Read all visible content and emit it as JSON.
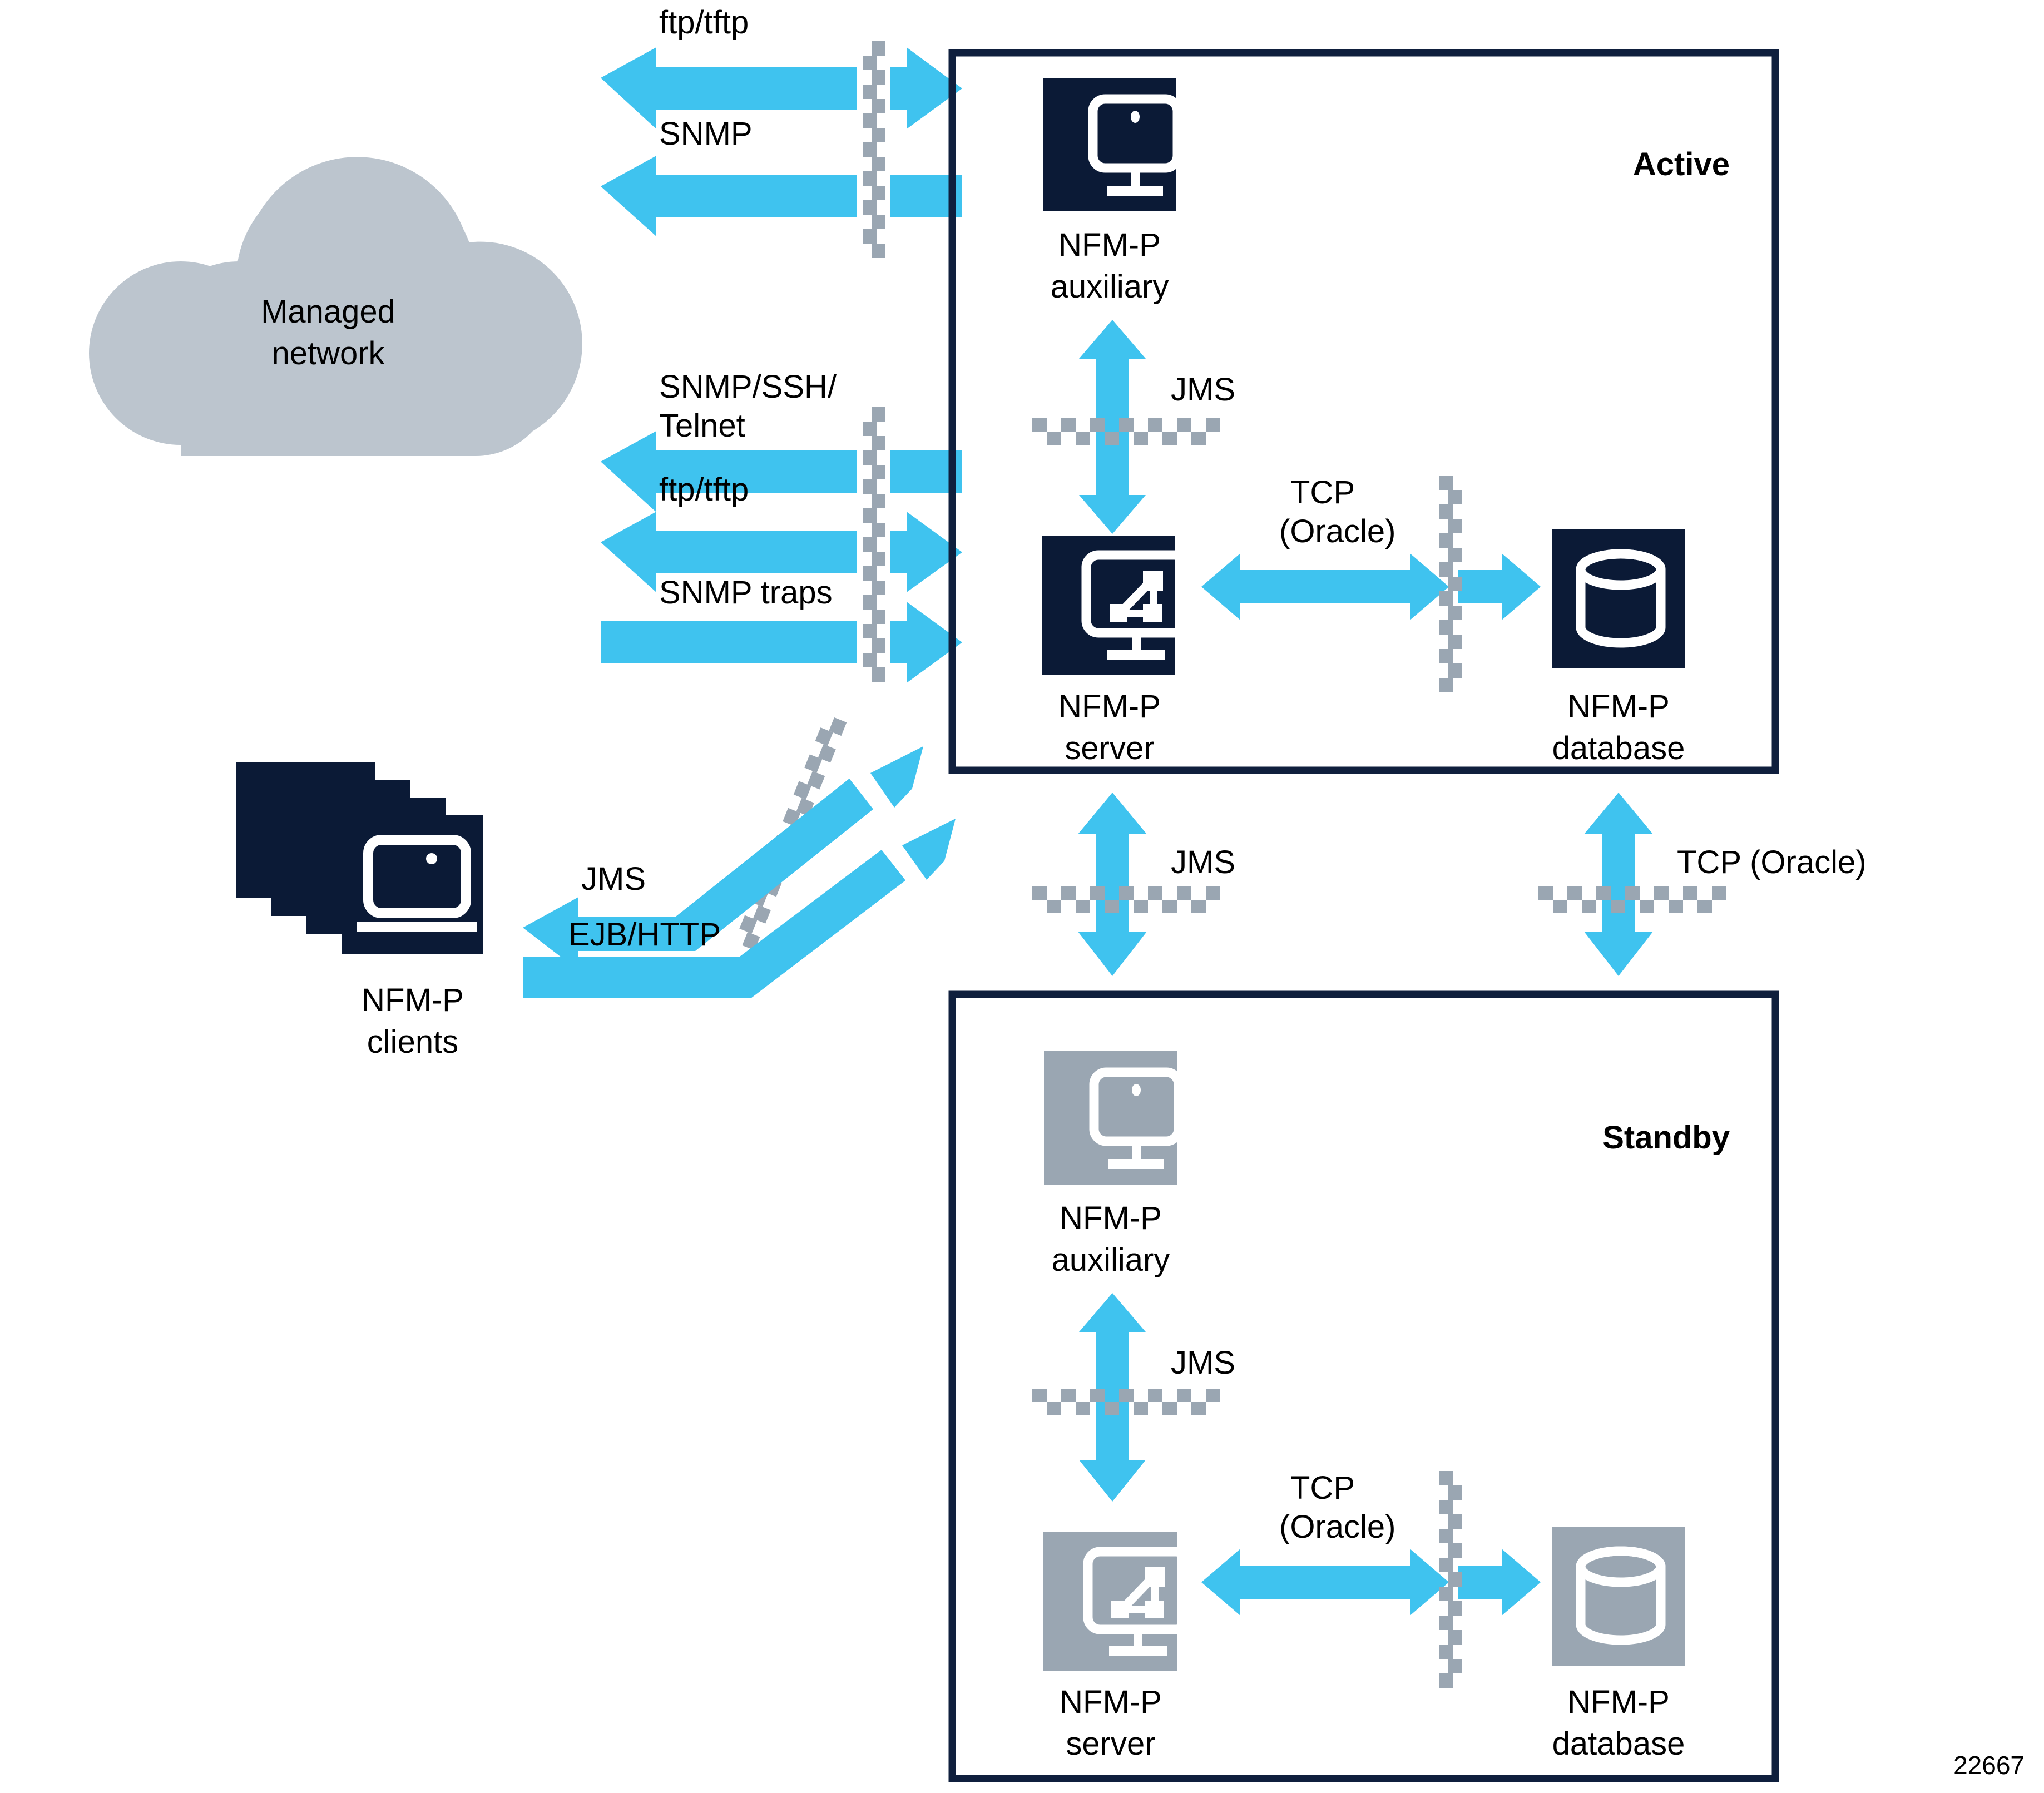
{
  "figure": {
    "id": "22667",
    "background": "#ffffff",
    "colors": {
      "arrow_blue": "#3FC3EF",
      "node_navy": "#0B1A36",
      "node_gray": "#9AA6B2",
      "cloud_gray": "#BCC5CE",
      "firewall_gray": "#9AA6B2",
      "border_navy": "#0F1F3D",
      "text_black": "#000000",
      "icon_white": "#ffffff"
    }
  },
  "cloud": {
    "label_line1": "Managed",
    "label_line2": "network"
  },
  "clients": {
    "label_line1": "NFM-P",
    "label_line2": "clients",
    "icon": "client-stack-icon",
    "stack_count": 4
  },
  "active_group": {
    "title": "Active",
    "nodes": [
      {
        "id": "active-auxiliary",
        "label_line1": "NFM-P",
        "label_line2": "auxiliary",
        "icon": "monitor-icon",
        "color": "#0B1A36"
      },
      {
        "id": "active-server",
        "label_line1": "NFM-P",
        "label_line2": "server",
        "icon": "server-topology-icon",
        "color": "#0B1A36"
      },
      {
        "id": "active-database",
        "label_line1": "NFM-P",
        "label_line2": "database",
        "icon": "database-cylinder-icon",
        "color": "#0B1A36"
      }
    ],
    "internal_links": [
      {
        "id": "active-jms-link",
        "label": "JMS",
        "direction": "bidirectional-vertical",
        "firewall": true
      },
      {
        "id": "active-tcp-link",
        "label_line1": "TCP",
        "label_line2": "(Oracle)",
        "direction": "bidirectional-horizontal",
        "firewall": true
      }
    ]
  },
  "standby_group": {
    "title": "Standby",
    "nodes": [
      {
        "id": "standby-auxiliary",
        "label_line1": "NFM-P",
        "label_line2": "auxiliary",
        "icon": "monitor-icon",
        "color": "#9AA6B2"
      },
      {
        "id": "standby-server",
        "label_line1": "NFM-P",
        "label_line2": "server",
        "icon": "server-topology-icon",
        "color": "#9AA6B2"
      },
      {
        "id": "standby-database",
        "label_line1": "NFM-P",
        "label_line2": "database",
        "icon": "database-cylinder-icon",
        "color": "#9AA6B2"
      }
    ],
    "internal_links": [
      {
        "id": "standby-jms-link",
        "label": "JMS",
        "direction": "bidirectional-vertical",
        "firewall": true
      },
      {
        "id": "standby-tcp-link",
        "label_line1": "TCP",
        "label_line2": "(Oracle)",
        "direction": "bidirectional-horizontal",
        "firewall": true
      }
    ]
  },
  "network_flows": [
    {
      "id": "flow-ftp-tftp-top",
      "label": "ftp/tftp",
      "direction": "bidirectional",
      "from": "Managed network",
      "to": "NFM-P auxiliary",
      "firewall": true
    },
    {
      "id": "flow-snmp-top",
      "label": "SNMP",
      "direction": "left",
      "from": "NFM-P auxiliary",
      "to": "Managed network",
      "firewall": true
    },
    {
      "id": "flow-snmp-ssh-telnet",
      "label_line1": "SNMP/SSH/",
      "label_line2": "Telnet",
      "direction": "left",
      "from": "NFM-P server",
      "to": "Managed network",
      "firewall": true
    },
    {
      "id": "flow-ftp-tftp-mid",
      "label": "ftp/tftp",
      "direction": "bidirectional",
      "from": "Managed network",
      "to": "NFM-P server",
      "firewall": true
    },
    {
      "id": "flow-snmp-traps",
      "label": "SNMP traps",
      "direction": "right",
      "from": "Managed network",
      "to": "NFM-P server",
      "firewall": true
    }
  ],
  "client_flows": [
    {
      "id": "flow-jms-clients",
      "label": "JMS",
      "direction": "bidirectional-diagonal",
      "from": "NFM-P server",
      "to": "NFM-P clients",
      "firewall": true
    },
    {
      "id": "flow-ejb-http-clients",
      "label": "EJB/HTTP",
      "direction": "up-right",
      "from": "NFM-P clients",
      "to": "NFM-P server",
      "firewall": true
    }
  ],
  "redundancy_links": [
    {
      "id": "link-jms-active-standby",
      "label": "JMS",
      "direction": "bidirectional-vertical",
      "from": "Active NFM-P server",
      "to": "Standby NFM-P auxiliary",
      "firewall": true
    },
    {
      "id": "link-tcp-oracle-db",
      "label": "TCP (Oracle)",
      "direction": "bidirectional-vertical",
      "from": "Active NFM-P database",
      "to": "Standby NFM-P database",
      "firewall": true
    }
  ]
}
